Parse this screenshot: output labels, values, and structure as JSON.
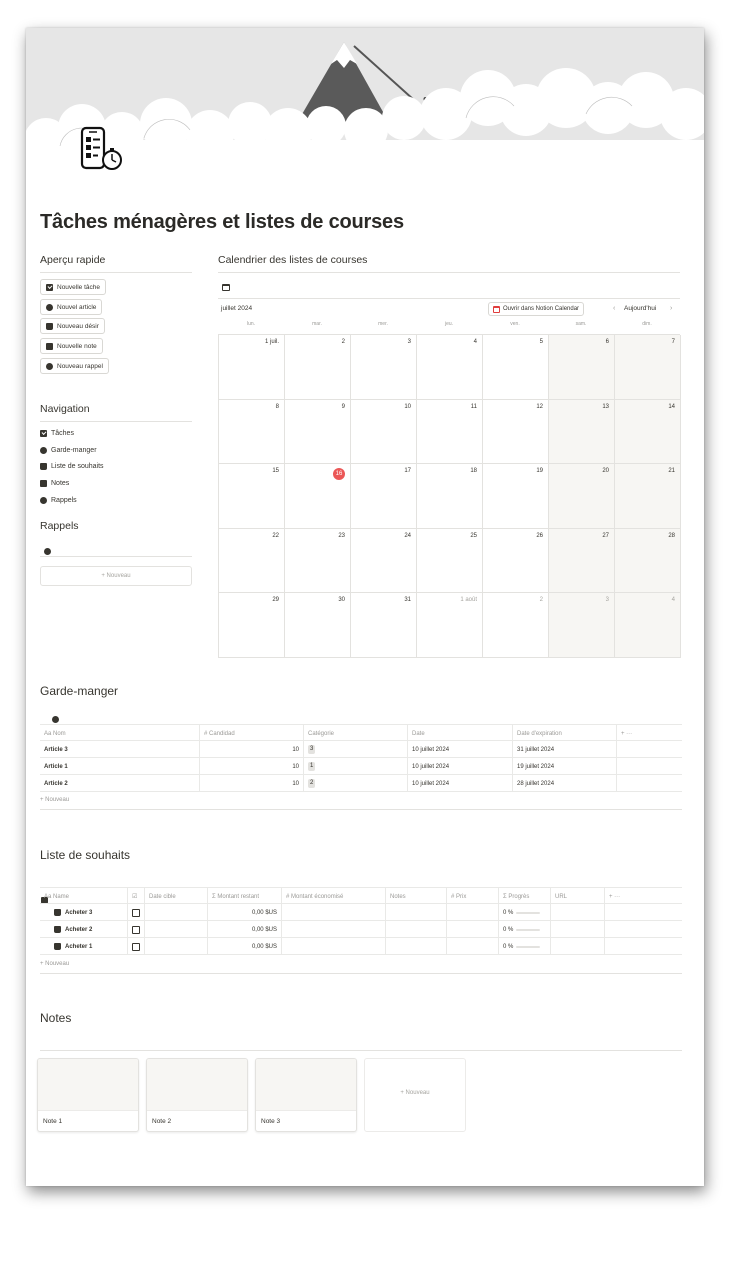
{
  "page": {
    "title": "Tâches ménagères et listes de courses"
  },
  "quick": {
    "heading": "Aperçu rapide",
    "buttons": [
      "Nouvelle tâche",
      "Nouvel article",
      "Nouveau désir",
      "Nouvelle note",
      "Nouveau rappel"
    ]
  },
  "navigation": {
    "heading": "Navigation",
    "items": [
      "Tâches",
      "Garde-manger",
      "Liste de souhaits",
      "Notes",
      "Rappels"
    ]
  },
  "reminders": {
    "heading": "Rappels",
    "new_label": "+ Nouveau"
  },
  "calendar": {
    "heading": "Calendrier des listes de courses",
    "month": "juillet 2024",
    "open_label": "Ouvrir dans Notion Calendar",
    "today_label": "Aujourd'hui",
    "weekdays": [
      "lun.",
      "mar.",
      "mer.",
      "jeu.",
      "ven.",
      "sam.",
      "dim."
    ],
    "weeks": [
      [
        "1 juil.",
        "2",
        "3",
        "4",
        "5",
        "6",
        "7"
      ],
      [
        "8",
        "9",
        "10",
        "11",
        "12",
        "13",
        "14"
      ],
      [
        "15",
        "16",
        "17",
        "18",
        "19",
        "20",
        "21"
      ],
      [
        "22",
        "23",
        "24",
        "25",
        "26",
        "27",
        "28"
      ],
      [
        "29",
        "30",
        "31",
        "1 août",
        "2",
        "3",
        "4"
      ]
    ],
    "today": "16"
  },
  "pantry": {
    "heading": "Garde-manger",
    "columns": [
      "Aa Nom",
      "# Candidad",
      "Catégorie",
      "Date",
      "Date d'expiration",
      "+  ···"
    ],
    "rows": [
      {
        "name": "Article 3",
        "qty": "10",
        "cat": "3",
        "date": "10 juillet 2024",
        "exp": "31 juillet 2024"
      },
      {
        "name": "Article 1",
        "qty": "10",
        "cat": "1",
        "date": "10 juillet 2024",
        "exp": "19 juillet 2024"
      },
      {
        "name": "Article 2",
        "qty": "10",
        "cat": "2",
        "date": "10 juillet 2024",
        "exp": "28 juillet 2024"
      }
    ],
    "new_label": "+ Nouveau"
  },
  "wishlist": {
    "heading": "Liste de souhaits",
    "columns": [
      "Aa Name",
      "☑",
      "Date cible",
      "Σ Montant restant",
      "# Montant économisé",
      "Notes",
      "# Prix",
      "Σ Progrès",
      "URL",
      "+  ···"
    ],
    "rows": [
      {
        "name": "Acheter 3",
        "remaining": "0,00 $US",
        "progress": "0 %"
      },
      {
        "name": "Acheter 2",
        "remaining": "0,00 $US",
        "progress": "0 %"
      },
      {
        "name": "Acheter 1",
        "remaining": "0,00 $US",
        "progress": "0 %"
      }
    ],
    "new_label": "+ Nouveau"
  },
  "notes": {
    "heading": "Notes",
    "cards": [
      "Note 1",
      "Note 2",
      "Note 3"
    ],
    "new_label": "+ Nouveau"
  },
  "colors": {
    "today": "#eb5757",
    "calendar_icon": "#e03e3e",
    "weekend_bg": "#f7f6f3"
  }
}
